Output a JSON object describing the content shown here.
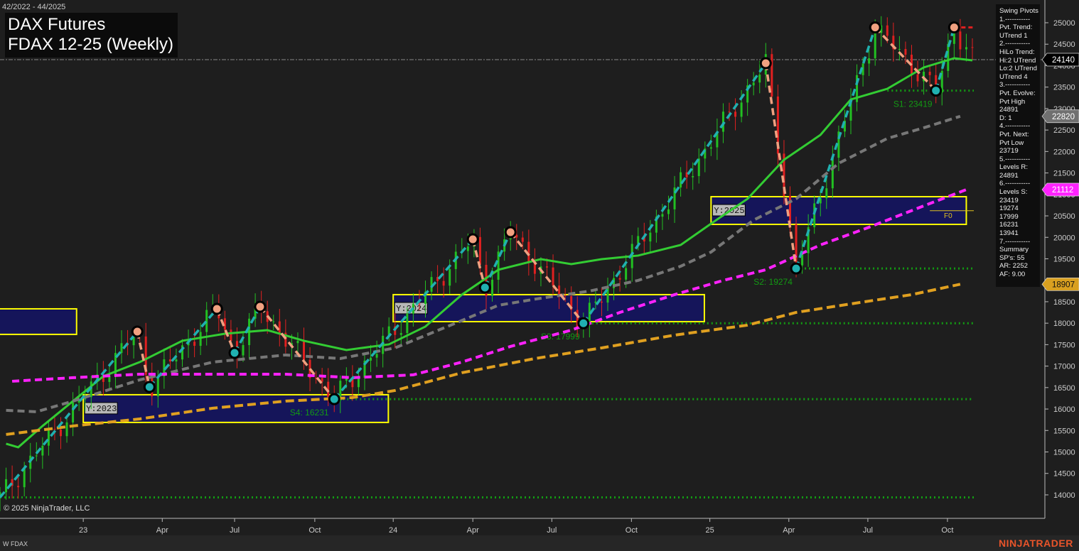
{
  "header": {
    "date_range": "42/2022 - 44/2025",
    "title_line1": "DAX Futures",
    "title_line2": "FDAX 12-25 (Weekly)"
  },
  "info_panel": {
    "lines": [
      "Swing Pivots",
      "1.-----------",
      "Pvt. Trend:",
      "UTrend 1",
      "2.-----------",
      "HiLo Trend:",
      "Hi:2 UTrend",
      "Lo:2 UTrend",
      "UTrend 4",
      "3.-----------",
      "Pvt. Evolve:",
      "Pvt High",
      "24891",
      "D: 1",
      "4.-----------",
      "Pvt. Next:",
      "Pvt Low",
      "23719",
      "5.-----------",
      "Levels R:",
      "24891",
      "6.-----------",
      "Levels S:",
      "23419",
      "19274",
      "17999",
      "16231",
      "13941",
      "7.-----------",
      "Summary",
      "SP's: 55",
      "AR: 2252",
      "AF: 9.00"
    ]
  },
  "footer": {
    "copyright": "© 2025 NinjaTrader, LLC",
    "instrument": "W FDAX",
    "logo": "NINJATRADER"
  },
  "colors": {
    "background": "#1e1e1e",
    "up_candle": "#22c022",
    "down_candle": "#e02020",
    "fast_ma": "#33cc33",
    "mid_ma": "#777777",
    "slow_ma": "#ff22ff",
    "long_ma": "#e0a020",
    "swing_up": "#20b0b0",
    "swing_down": "#f0a080",
    "support": "#139a13",
    "range_box_fill": "#15155a",
    "range_box_border": "#ffff00"
  },
  "chart_data": {
    "type": "line",
    "x_unit": "weeks since 42/2022",
    "ylim": [
      13600,
      25500
    ],
    "xlim": [
      0,
      171.6
    ],
    "y_ticks": [
      14000,
      14500,
      15000,
      15500,
      16000,
      16500,
      17000,
      17500,
      18000,
      18500,
      19000,
      19500,
      20000,
      20500,
      21000,
      21500,
      22000,
      22500,
      23000,
      23500,
      24000,
      24500,
      25000
    ],
    "x_ticks": [
      {
        "w": 13.7,
        "label": "23"
      },
      {
        "w": 26.7,
        "label": "Apr"
      },
      {
        "w": 38.6,
        "label": "Jul"
      },
      {
        "w": 51.8,
        "label": "Oct"
      },
      {
        "w": 64.7,
        "label": "24"
      },
      {
        "w": 77.8,
        "label": "Apr"
      },
      {
        "w": 90.8,
        "label": "Jul"
      },
      {
        "w": 103.9,
        "label": "Oct"
      },
      {
        "w": 116.8,
        "label": "25"
      },
      {
        "w": 129.8,
        "label": "Apr"
      },
      {
        "w": 142.8,
        "label": "Jul"
      },
      {
        "w": 155.9,
        "label": "Oct"
      }
    ],
    "price_tags": [
      {
        "value": "24140",
        "bg": "#000000",
        "fg": "#ffffff",
        "price": 24140
      },
      {
        "value": "22820",
        "bg": "#707070",
        "fg": "#ffffff",
        "price": 22820
      },
      {
        "value": "21112",
        "bg": "#ff22ff",
        "fg": "#ffffff",
        "price": 21112
      },
      {
        "value": "18907",
        "bg": "#d9a020",
        "fg": "#111111",
        "price": 18907
      }
    ],
    "last_price": 24140,
    "swing_pivots": [
      [
        0,
        13941,
        "L"
      ],
      [
        22.6,
        17804,
        "H"
      ],
      [
        24.6,
        16514,
        "L"
      ],
      [
        35.7,
        18333,
        "H"
      ],
      [
        38.6,
        17308,
        "L"
      ],
      [
        42.8,
        18383,
        "H"
      ],
      [
        55,
        16231,
        "L"
      ],
      [
        77.8,
        19954,
        "H"
      ],
      [
        79.8,
        18830,
        "L"
      ],
      [
        84,
        20120,
        "H"
      ],
      [
        96,
        17999,
        "L"
      ],
      [
        126,
        24057,
        "H"
      ],
      [
        131,
        19274,
        "L"
      ],
      [
        144,
        24891,
        "H"
      ],
      [
        154,
        23419,
        "L"
      ],
      [
        157,
        24891,
        "H"
      ]
    ],
    "moving_averages": [
      {
        "name": "fast",
        "color": "#33cc33",
        "dash": "",
        "points": [
          [
            1,
            15191
          ],
          [
            3,
            15109
          ],
          [
            7,
            15605
          ],
          [
            12,
            16184
          ],
          [
            17,
            16763
          ],
          [
            23,
            17094
          ],
          [
            30,
            17590
          ],
          [
            37,
            17755
          ],
          [
            44,
            17838
          ],
          [
            50,
            17590
          ],
          [
            57,
            17375
          ],
          [
            64,
            17507
          ],
          [
            70,
            17921
          ],
          [
            76,
            18665
          ],
          [
            82,
            19244
          ],
          [
            89,
            19492
          ],
          [
            94,
            19376
          ],
          [
            99,
            19492
          ],
          [
            105,
            19575
          ],
          [
            112,
            19823
          ],
          [
            117,
            20319
          ],
          [
            123,
            20898
          ],
          [
            129,
            21807
          ],
          [
            135,
            22386
          ],
          [
            140,
            23213
          ],
          [
            146,
            23461
          ],
          [
            152,
            23958
          ],
          [
            157,
            24173
          ],
          [
            160,
            24123
          ]
        ]
      },
      {
        "name": "mid",
        "color": "#777777",
        "dash": "10 6",
        "points": [
          [
            1,
            15969
          ],
          [
            6,
            15936
          ],
          [
            12,
            16184
          ],
          [
            23,
            16680
          ],
          [
            35,
            17094
          ],
          [
            47,
            17259
          ],
          [
            56,
            17176
          ],
          [
            65,
            17424
          ],
          [
            75,
            18003
          ],
          [
            82,
            18417
          ],
          [
            89,
            18582
          ],
          [
            97,
            18748
          ],
          [
            105,
            18996
          ],
          [
            112,
            19326
          ],
          [
            117,
            19657
          ],
          [
            124,
            20402
          ],
          [
            131,
            20898
          ],
          [
            138,
            21725
          ],
          [
            146,
            22304
          ],
          [
            152,
            22552
          ],
          [
            158,
            22820
          ]
        ]
      },
      {
        "name": "slow",
        "color": "#ff22ff",
        "dash": "10 6",
        "points": [
          [
            2,
            16647
          ],
          [
            12,
            16730
          ],
          [
            23,
            16812
          ],
          [
            35,
            16812
          ],
          [
            47,
            16812
          ],
          [
            58,
            16730
          ],
          [
            68,
            16796
          ],
          [
            76,
            17094
          ],
          [
            84,
            17458
          ],
          [
            94,
            17838
          ],
          [
            102,
            18251
          ],
          [
            111,
            18665
          ],
          [
            119,
            18996
          ],
          [
            126,
            19244
          ],
          [
            135,
            19823
          ],
          [
            143,
            20236
          ],
          [
            152,
            20733
          ],
          [
            159,
            21112
          ]
        ]
      },
      {
        "name": "long",
        "color": "#e0a020",
        "dash": "12 6",
        "points": [
          [
            1,
            15407
          ],
          [
            12,
            15605
          ],
          [
            23,
            15770
          ],
          [
            35,
            16019
          ],
          [
            47,
            16184
          ],
          [
            58,
            16267
          ],
          [
            65,
            16432
          ],
          [
            76,
            16845
          ],
          [
            88,
            17176
          ],
          [
            99,
            17424
          ],
          [
            111,
            17722
          ],
          [
            123,
            17954
          ],
          [
            131,
            18251
          ],
          [
            140,
            18450
          ],
          [
            150,
            18665
          ],
          [
            158,
            18907
          ]
        ]
      }
    ],
    "support_levels": [
      {
        "label": "S1: 23419",
        "price": 23419,
        "from_w": 146,
        "label_w": 147
      },
      {
        "label": "S2: 19274",
        "price": 19274,
        "from_w": 131,
        "label_w": 124
      },
      {
        "label": "S3: 17999",
        "price": 17999,
        "from_w": 96,
        "label_w": 89
      },
      {
        "label": "S4: 16231",
        "price": 16231,
        "from_w": 55,
        "label_w": 47.7
      },
      {
        "label": "",
        "price": 13941,
        "from_w": 0,
        "label_w": 0
      }
    ],
    "resistance_level": {
      "price": 24891,
      "from_w": 157
    },
    "range_boxes": [
      {
        "label": "",
        "w0": -1,
        "w1": 12.6,
        "top": 18334,
        "bottom": 17739
      },
      {
        "label": "Y:2023",
        "w0": 13.7,
        "w1": 63.9,
        "top": 16333,
        "bottom": 15688
      },
      {
        "label": "Y:2024",
        "w0": 64.7,
        "w1": 115.9,
        "top": 18665,
        "bottom": 18036
      },
      {
        "label": "Y:2025",
        "w0": 117,
        "w1": 159,
        "top": 20947,
        "bottom": 20302
      }
    ],
    "f0": {
      "label": "F0",
      "price": 20620
    }
  }
}
